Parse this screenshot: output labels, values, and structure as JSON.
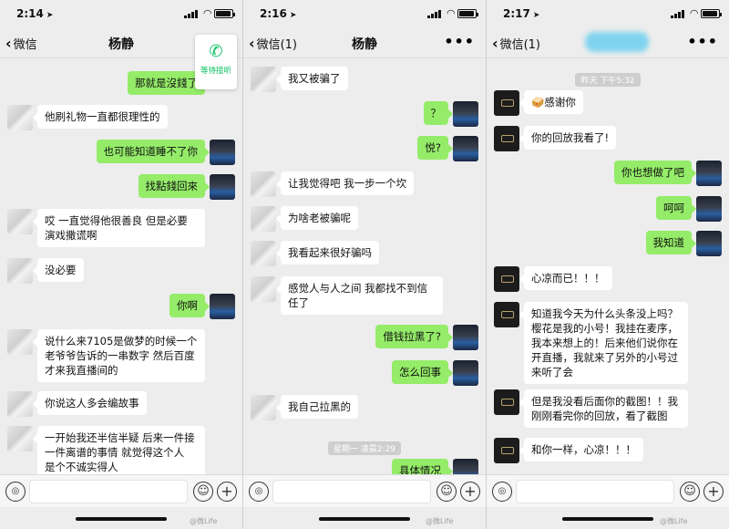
{
  "panels": [
    {
      "time": "2:14",
      "back": "微信",
      "title": "杨静",
      "call_popup": {
        "label": "等待接听",
        "icon": "phone-icon"
      },
      "messages": [
        {
          "side": "out",
          "text": "那就是沒錢了"
        },
        {
          "side": "in",
          "text": "他刷礼物一直都很理性的"
        },
        {
          "side": "out",
          "text": "也可能知道睡不了你"
        },
        {
          "side": "out",
          "text": "找點錢回來"
        },
        {
          "side": "in",
          "text": "哎 一直觉得他很善良 但是必要演戏撒谎啊"
        },
        {
          "side": "in",
          "text": "没必要"
        },
        {
          "side": "out",
          "text": "你啊"
        },
        {
          "side": "in",
          "text": "说什么来7105是做梦的时候一个老爷爷告诉的一串数字 然后百度才来我直播间的"
        },
        {
          "side": "in",
          "text": "你说这人多会编故事"
        },
        {
          "side": "in",
          "text": "一开始我还半信半疑 后来一件接一件离谱的事情 就觉得这个人 是个不诚实得人"
        }
      ],
      "watermark": "@微Life"
    },
    {
      "time": "2:16",
      "back": "微信(1)",
      "title": "杨静",
      "messages": [
        {
          "side": "in",
          "text": "我又被骗了"
        },
        {
          "side": "out",
          "text": "？"
        },
        {
          "side": "out",
          "text": "悦?"
        },
        {
          "side": "in",
          "text": "让我觉得吧 我一步一个坎"
        },
        {
          "side": "in",
          "text": "为啥老被骗呢"
        },
        {
          "side": "in",
          "text": "我看起来很好骗吗"
        },
        {
          "side": "in",
          "text": "感觉人与人之间 我都找不到信任了"
        },
        {
          "side": "out",
          "text": "借钱拉黑了?"
        },
        {
          "side": "out",
          "text": "怎么回事"
        },
        {
          "side": "in",
          "text": "我自己拉黑的"
        },
        {
          "side": "out",
          "text": "具体情况"
        }
      ],
      "timestamp": "星期一 凌晨2:29",
      "watermark": "@微Life"
    },
    {
      "time": "2:17",
      "back": "微信(1)",
      "title": "",
      "messages": [
        {
          "side": "in",
          "text": "🥪感谢你"
        },
        {
          "side": "in",
          "text": "你的回放我看了!"
        },
        {
          "side": "out",
          "text": "你也想做了吧"
        },
        {
          "side": "out",
          "text": "呵呵"
        },
        {
          "side": "out",
          "text": "我知道"
        },
        {
          "side": "in",
          "text": "心凉而已！！！"
        },
        {
          "side": "in",
          "text": "知道我今天为什么头条没上吗？樱花是我的小号！我挂在麦序，我本来想上的！后来他们说你在开直播，我就来了另外的小号过来听了会"
        },
        {
          "side": "in",
          "text": "但是我没看后面你的截图！！我刚刚看完你的回放，看了截图"
        },
        {
          "side": "in",
          "text": "和你一样，心凉！！！"
        }
      ],
      "timestamp": "昨天 下午5:32",
      "watermark": "@微Life"
    }
  ],
  "colors": {
    "outgoing_bubble": "#95ec69",
    "incoming_bubble": "#ffffff",
    "background": "#ededed",
    "accent": "#07c160"
  }
}
